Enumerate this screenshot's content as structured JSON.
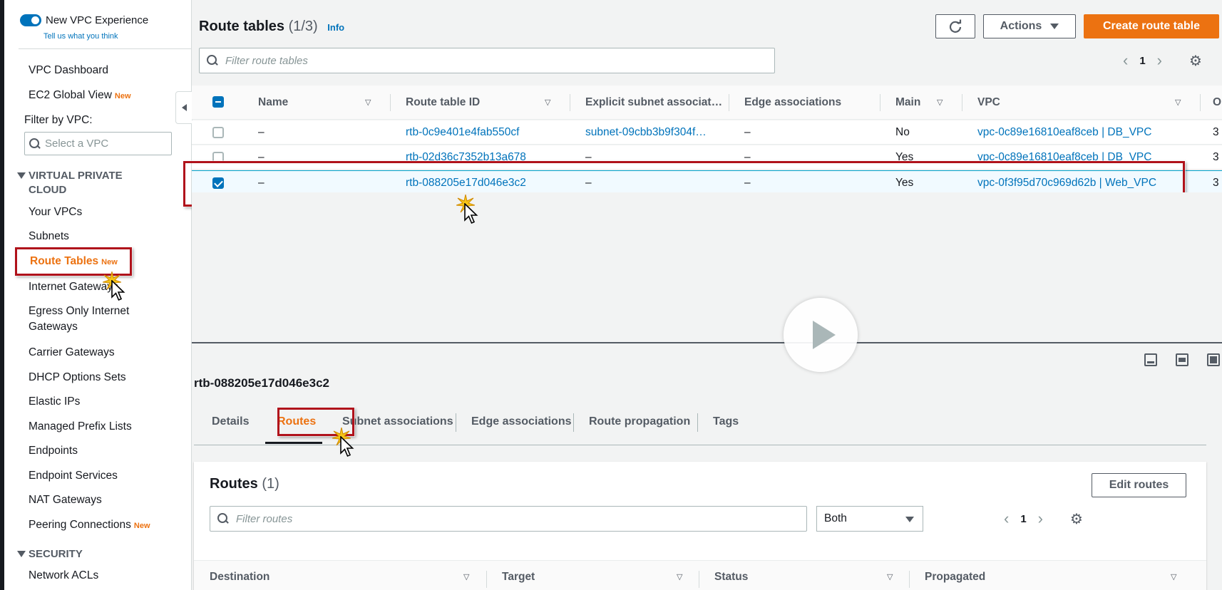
{
  "sidebar": {
    "toggle_label": "New VPC Experience",
    "tell_us": "Tell us what you think",
    "items_top": [
      {
        "label": "VPC Dashboard",
        "badge": ""
      },
      {
        "label": "EC2 Global View",
        "badge": "New"
      }
    ],
    "filter_label": "Filter by VPC:",
    "vpc_placeholder": "Select a VPC",
    "section_vpc": "VIRTUAL PRIVATE CLOUD",
    "vpc_items": [
      {
        "label": "Your VPCs",
        "badge": ""
      },
      {
        "label": "Subnets",
        "badge": ""
      },
      {
        "label": "Route Tables",
        "badge": "New"
      },
      {
        "label": "Internet Gateways",
        "badge": ""
      },
      {
        "label": "Egress Only Internet Gateways",
        "badge": ""
      },
      {
        "label": "Carrier Gateways",
        "badge": ""
      },
      {
        "label": "DHCP Options Sets",
        "badge": ""
      },
      {
        "label": "Elastic IPs",
        "badge": ""
      },
      {
        "label": "Managed Prefix Lists",
        "badge": ""
      },
      {
        "label": "Endpoints",
        "badge": ""
      },
      {
        "label": "Endpoint Services",
        "badge": ""
      },
      {
        "label": "NAT Gateways",
        "badge": ""
      },
      {
        "label": "Peering Connections",
        "badge": "New"
      }
    ],
    "section_security": "SECURITY",
    "security_items": [
      {
        "label": "Network ACLs",
        "badge": ""
      }
    ]
  },
  "header": {
    "title": "Route tables",
    "count": "(1/3)",
    "info": "Info",
    "actions_label": "Actions",
    "create_label": "Create route table",
    "filter_placeholder": "Filter route tables",
    "page": "1"
  },
  "table": {
    "columns": [
      "Name",
      "Route table ID",
      "Explicit subnet associat…",
      "Edge associations",
      "Main",
      "VPC",
      "O"
    ],
    "rows": [
      {
        "name": "–",
        "id": "rtb-0c9e401e4fab550cf",
        "subnet": "subnet-09cbb3b9f304f…",
        "edge": "–",
        "main": "No",
        "vpc": "vpc-0c89e16810eaf8ceb | DB_VPC",
        "owner": "3",
        "selected": false
      },
      {
        "name": "–",
        "id": "rtb-02d36c7352b13a678",
        "subnet": "–",
        "edge": "–",
        "main": "Yes",
        "vpc": "vpc-0c89e16810eaf8ceb | DB_VPC",
        "owner": "3",
        "selected": false
      },
      {
        "name": "–",
        "id": "rtb-088205e17d046e3c2",
        "subnet": "–",
        "edge": "–",
        "main": "Yes",
        "vpc": "vpc-0f3f95d70c969d62b | Web_VPC",
        "owner": "3",
        "selected": true
      }
    ]
  },
  "details": {
    "title": "rtb-088205e17d046e3c2",
    "tabs": [
      "Details",
      "Routes",
      "Subnet associations",
      "Edge associations",
      "Route propagation",
      "Tags"
    ],
    "active_tab": "Routes",
    "routes_title": "Routes",
    "routes_count": "(1)",
    "edit_routes": "Edit routes",
    "filter_routes_placeholder": "Filter routes",
    "both_select": "Both",
    "page": "1",
    "columns": [
      "Destination",
      "Target",
      "Status",
      "Propagated"
    ]
  },
  "colors": {
    "accent": "#ec7211",
    "link": "#0073bb",
    "highlight": "#b0121b"
  }
}
